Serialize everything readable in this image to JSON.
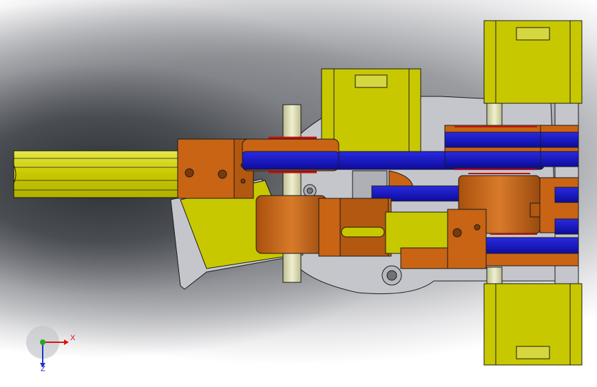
{
  "viewport": {
    "background_top": "#3a3d42",
    "background_bottom": "#ffffff"
  },
  "model": {
    "colors": {
      "yellow_body": "#c8c800",
      "yellow_light": "#e6e64a",
      "orange_part": "#c86414",
      "orange_dark": "#9a4a0e",
      "blue_belt": "#1414c8",
      "gray_plate": "#c4c6cc",
      "shaft": "#d8d8b0",
      "outline": "#1a1a1a"
    }
  },
  "triad": {
    "x_label": "X",
    "y_label": "Z"
  }
}
